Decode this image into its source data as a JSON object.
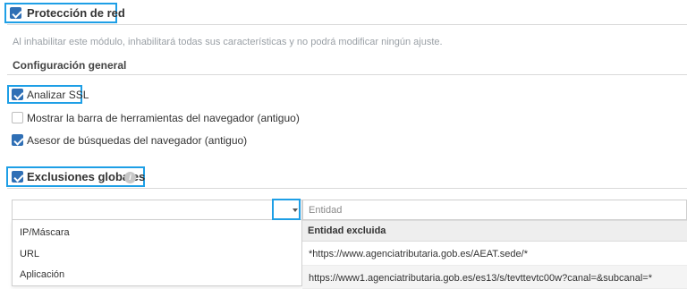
{
  "network_protection": {
    "title": "Protección de red",
    "checked": true,
    "notice": "Al inhabilitar este módulo, inhabilitará todas sus características y no podrá modificar ningún ajuste."
  },
  "general_config": {
    "title": "Configuración general",
    "options": [
      {
        "label": "Analizar SSL",
        "checked": true
      },
      {
        "label": "Mostrar la barra de herramientas del navegador (antiguo)",
        "checked": false
      },
      {
        "label": "Asesor de búsquedas del navegador (antiguo)",
        "checked": true
      }
    ]
  },
  "global_exclusions": {
    "title": "Exclusiones globales",
    "checked": true,
    "info_icon": "info-icon",
    "type_select": {
      "value": "",
      "options": [
        "IP/Máscara",
        "URL",
        "Aplicación"
      ]
    },
    "entity_input": {
      "placeholder": "Entidad"
    },
    "table": {
      "header": "Entidad excluida",
      "rows": [
        "*https://www.agenciatributaria.gob.es/AEAT.sede/*",
        "https://www1.agenciatributaria.gob.es/es13/s/tevttevtc00w?canal=&subcanal=*"
      ]
    }
  },
  "colors": {
    "checkbox": "#2f6fb5",
    "highlight": "#1e9fe6"
  }
}
